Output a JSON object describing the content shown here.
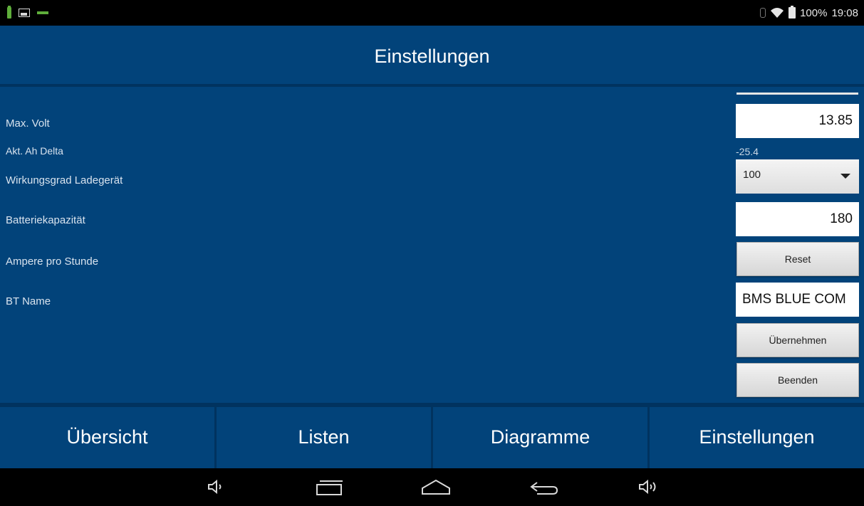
{
  "status_bar": {
    "battery_percent": "100%",
    "time": "19:08",
    "icons": [
      "battery-charging-icon",
      "image-icon",
      "signal-bar-icon",
      "bluetooth-icon",
      "wifi-icon",
      "battery-icon"
    ]
  },
  "header": {
    "title": "Einstellungen"
  },
  "settings": {
    "max_volt": {
      "label": "Max. Volt",
      "value": "13.85"
    },
    "ah_delta": {
      "label": "Akt. Ah Delta",
      "value": "-25.4"
    },
    "charger_efficiency": {
      "label": "Wirkungsgrad Ladegerät",
      "value": "100"
    },
    "battery_capacity": {
      "label": "Batteriekapazität",
      "value": "180"
    },
    "ampere_per_hour": {
      "label": "Ampere pro Stunde",
      "button": "Reset"
    },
    "bt_name": {
      "label": "BT Name",
      "value": "BMS BLUE COM"
    },
    "apply_button": "Übernehmen",
    "exit_button": "Beenden"
  },
  "tabs": [
    {
      "label": "Übersicht"
    },
    {
      "label": "Listen"
    },
    {
      "label": "Diagramme"
    },
    {
      "label": "Einstellungen"
    }
  ],
  "navbar": {
    "icons": [
      "volume-down-icon",
      "recent-apps-icon",
      "home-icon",
      "back-icon",
      "volume-up-icon"
    ]
  },
  "colors": {
    "background": "#02437a",
    "divider": "#01335f",
    "status_bar": "#000000",
    "field_background": "#ffffff"
  }
}
